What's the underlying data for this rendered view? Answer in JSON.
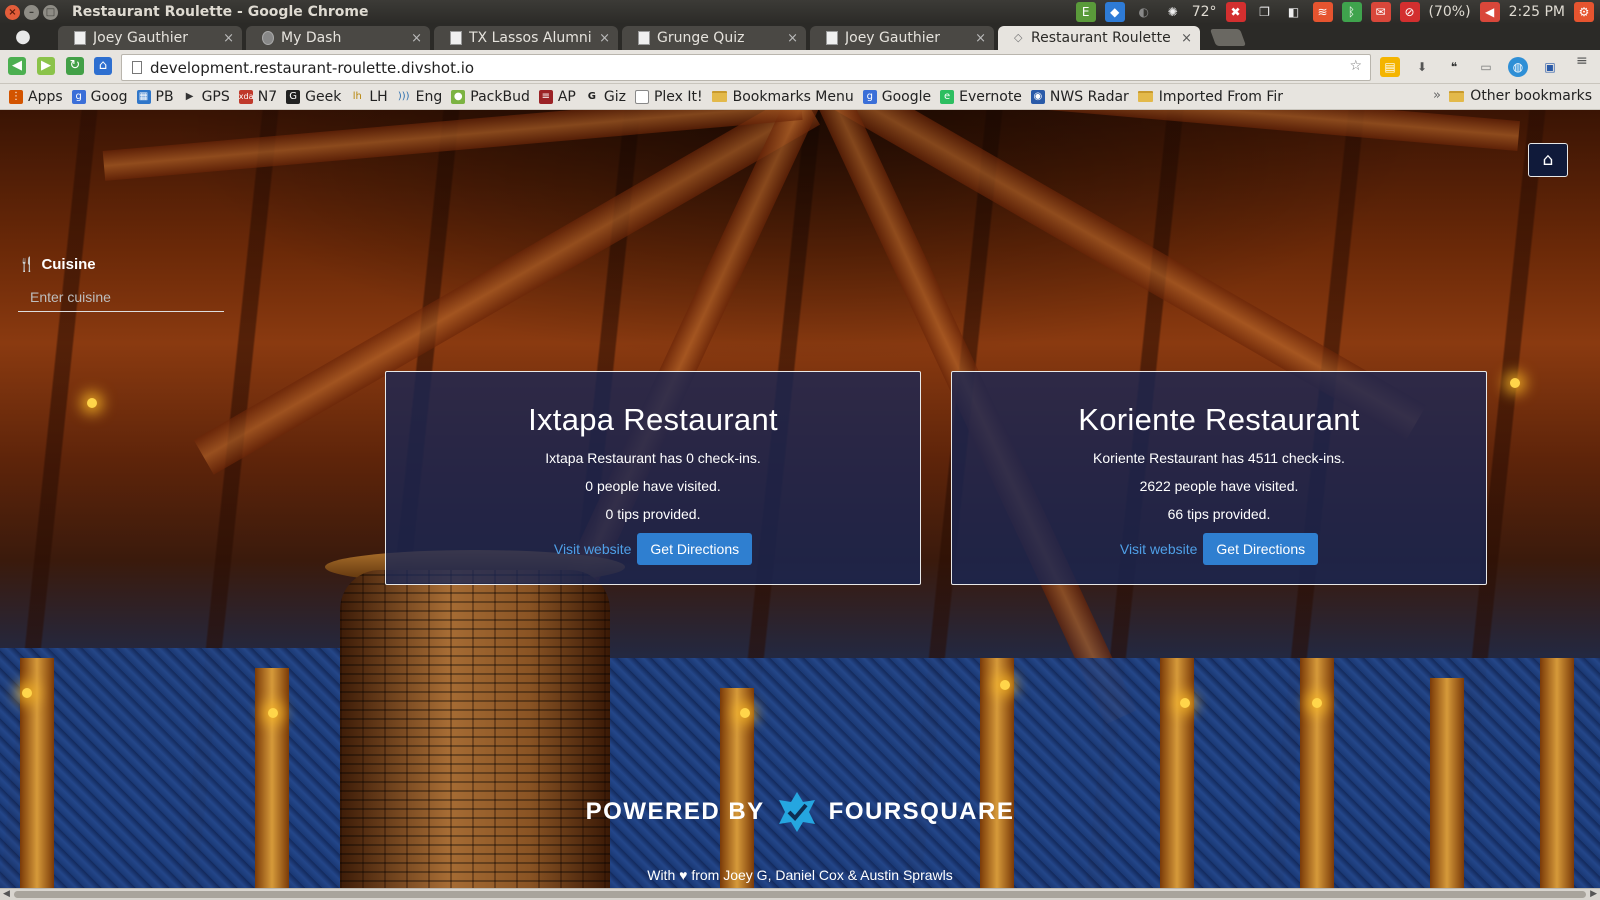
{
  "os": {
    "window_title": "Restaurant Roulette - Google Chrome",
    "temperature": "72°",
    "battery": "(70%)",
    "clock": "2:25 PM"
  },
  "tabs": [
    {
      "label": "Joey Gauthier",
      "close": "×"
    },
    {
      "label": "My Dash",
      "close": "×"
    },
    {
      "label": "TX Lassos Alumni",
      "close": "×"
    },
    {
      "label": "Grunge Quiz",
      "close": "×"
    },
    {
      "label": "Joey Gauthier",
      "close": "×"
    },
    {
      "label": "Restaurant Roulette",
      "close": "×"
    }
  ],
  "address_bar": {
    "url": "development.restaurant-roulette.divshot.io"
  },
  "bookmarks": [
    {
      "label": "Apps",
      "icon": "apps-grid-icon",
      "color": "#d35400"
    },
    {
      "label": "Goog",
      "icon": "google-icon",
      "color": "#3b6fd8"
    },
    {
      "label": "PB",
      "icon": "pb-icon",
      "color": "#2f76c9"
    },
    {
      "label": "GPS",
      "icon": "play-store-icon",
      "color": "#333333"
    },
    {
      "label": "N7",
      "icon": "xda-icon",
      "color": "#c0392b"
    },
    {
      "label": "Geek",
      "icon": "geek-icon",
      "color": "#222222"
    },
    {
      "label": "LH",
      "icon": "lh-icon",
      "color": "#b8860b"
    },
    {
      "label": "Eng",
      "icon": "rss-icon",
      "color": "#2c6fb0"
    },
    {
      "label": "PackBud",
      "icon": "android-icon",
      "color": "#7cb342"
    },
    {
      "label": "AP",
      "icon": "ap-icon",
      "color": "#9b2226"
    },
    {
      "label": "Giz",
      "icon": "giz-icon",
      "color": "#222222"
    },
    {
      "label": "Plex It!",
      "icon": "page-icon",
      "color": "#ffffff"
    },
    {
      "label": "Bookmarks Menu",
      "icon": "folder-icon",
      "color": "#e3b94a"
    },
    {
      "label": "Google",
      "icon": "google-icon",
      "color": "#3b6fd8"
    },
    {
      "label": "Evernote",
      "icon": "evernote-icon",
      "color": "#2dbe60"
    },
    {
      "label": "NWS Radar",
      "icon": "radar-icon",
      "color": "#2a5aa8"
    },
    {
      "label": "Imported From Fir",
      "icon": "folder-icon",
      "color": "#e3b94a"
    }
  ],
  "other_bookmarks": "Other bookmarks",
  "bookmarks_overflow": "»",
  "sidebar": {
    "cuisine_label": "Cuisine",
    "cuisine_placeholder": "Enter cuisine",
    "cuisine_value": ""
  },
  "restaurants": [
    {
      "name": "Ixtapa Restaurant",
      "checkins_text": "Ixtapa Restaurant has 0 check-ins.",
      "visited_text": "0 people have visited.",
      "tips_text": "0 tips provided.",
      "visit_label": "Visit website",
      "directions_label": "Get Directions"
    },
    {
      "name": "Koriente Restaurant",
      "checkins_text": "Koriente Restaurant has 4511 check-ins.",
      "visited_text": "2622 people have visited.",
      "tips_text": "66 tips provided.",
      "visit_label": "Visit website",
      "directions_label": "Get Directions"
    }
  ],
  "footer": {
    "powered_by": "POWERED BY",
    "brand": "FOURSQUARE",
    "credits": "With ♥ from Joey G, Daniel Cox & Austin Sprawls"
  },
  "colors": {
    "card_bg": "#182656",
    "button": "#2f7fd0",
    "link": "#4fa0e8",
    "foursquare": "#25a6e0"
  }
}
